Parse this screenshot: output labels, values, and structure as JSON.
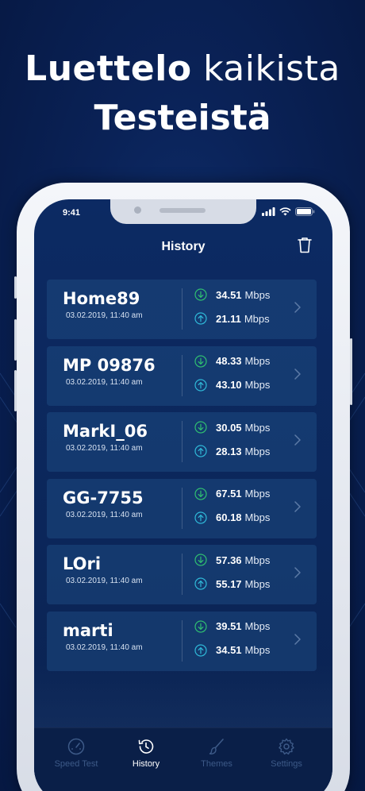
{
  "headline": {
    "line1_bold": "Luettelo",
    "line1_regular": "kaikista",
    "line2": "Testeistä"
  },
  "status": {
    "time": "9:41"
  },
  "header": {
    "title": "History",
    "delete_icon": "trash-icon"
  },
  "colors": {
    "download_icon": "#2fbf71",
    "upload_icon": "#2fb9d8",
    "card_bg": "#1b4478",
    "screen_bg": "#0b2659"
  },
  "history": [
    {
      "name": "Home89",
      "date": "03.02.2019, 11:40 am",
      "download": "34.51",
      "upload": "21.11",
      "unit": "Mbps"
    },
    {
      "name": "MP 09876",
      "date": "03.02.2019, 11:40 am",
      "download": "48.33",
      "upload": "43.10",
      "unit": "Mbps"
    },
    {
      "name": "MarkI_06",
      "date": "03.02.2019, 11:40 am",
      "download": "30.05",
      "upload": "28.13",
      "unit": "Mbps"
    },
    {
      "name": "GG-7755",
      "date": "03.02.2019, 11:40 am",
      "download": "67.51",
      "upload": "60.18",
      "unit": "Mbps"
    },
    {
      "name": "LOri",
      "date": "03.02.2019, 11:40 am",
      "download": "57.36",
      "upload": "55.17",
      "unit": "Mbps"
    },
    {
      "name": "marti",
      "date": "03.02.2019, 11:40 am",
      "download": "39.51",
      "upload": "34.51",
      "unit": "Mbps"
    }
  ],
  "tabs": [
    {
      "label": "Speed Test",
      "icon": "speedometer-icon",
      "active": false
    },
    {
      "label": "History",
      "icon": "history-icon",
      "active": true
    },
    {
      "label": "Themes",
      "icon": "brush-icon",
      "active": false
    },
    {
      "label": "Settings",
      "icon": "gear-icon",
      "active": false
    }
  ]
}
